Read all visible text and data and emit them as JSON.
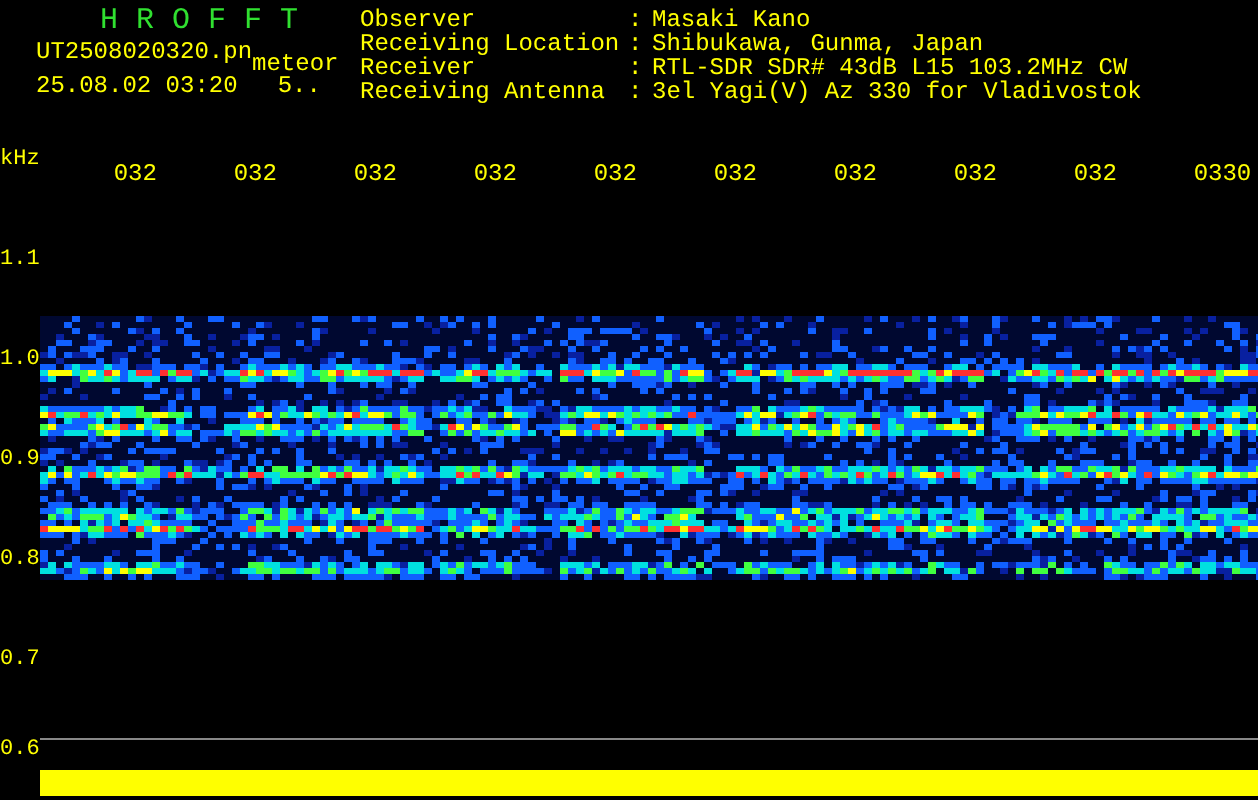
{
  "title": "H R O F F T",
  "file_name": "UT2508020320.pn",
  "mode_label": "meteor",
  "date_time": "25.08.02 03:20",
  "count": "5..",
  "info": [
    {
      "label": "Observer",
      "separator": ":",
      "value": "Masaki Kano"
    },
    {
      "label": "Receiving Location",
      "separator": ":",
      "value": "Shibukawa, Gunma, Japan"
    },
    {
      "label": "Receiver",
      "separator": ":",
      "value": "RTL-SDR SDR# 43dB L15 103.2MHz CW"
    },
    {
      "label": "Receiving Antenna",
      "separator": ":",
      "value": "3el Yagi(V) Az 330 for Vladivostok"
    }
  ],
  "axis_unit": "kHz",
  "time_labels": [
    "032",
    "032",
    "032",
    "032",
    "032",
    "032",
    "032",
    "032",
    "032",
    "0330"
  ],
  "freq_labels": [
    "1.1",
    "1.0",
    "0.9",
    "0.8",
    "0.7",
    "0.6"
  ]
}
